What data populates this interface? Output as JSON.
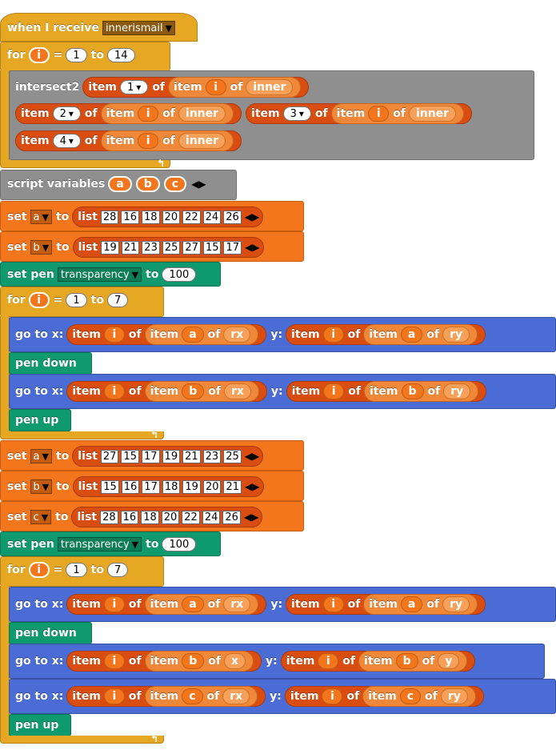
{
  "hat": {
    "label": "when I receive",
    "message": "innerismail"
  },
  "loop1": {
    "for_label": "for",
    "var": "i",
    "eq": "=",
    "from": "1",
    "to_label": "to",
    "to": "14"
  },
  "intersect": {
    "label": "intersect2",
    "item_label": "item",
    "of_label": "of",
    "list_name": "inner",
    "index_var": "i",
    "indices": [
      "1",
      "2",
      "3",
      "4"
    ]
  },
  "script_vars": {
    "label": "script variables",
    "vars": [
      "a",
      "b",
      "c"
    ]
  },
  "set_a1": {
    "set_label": "set",
    "var": "a",
    "to_label": "to",
    "list_label": "list",
    "values": [
      "28",
      "16",
      "18",
      "20",
      "22",
      "24",
      "26"
    ]
  },
  "set_b1": {
    "set_label": "set",
    "var": "b",
    "to_label": "to",
    "list_label": "list",
    "values": [
      "19",
      "21",
      "23",
      "25",
      "27",
      "15",
      "17"
    ]
  },
  "pen1": {
    "label": "set pen",
    "property": "transparency",
    "to_label": "to",
    "value": "100"
  },
  "loop2": {
    "for_label": "for",
    "var": "i",
    "eq": "=",
    "from": "1",
    "to_label": "to",
    "to": "7"
  },
  "goto_labels": {
    "goto": "go to x:",
    "y": "y:",
    "item": "item",
    "of": "of",
    "i": "i"
  },
  "goto1": {
    "x_var": "a",
    "x_list": "rx",
    "y_var": "a",
    "y_list": "ry"
  },
  "pen_down": "pen down",
  "goto2": {
    "x_var": "b",
    "x_list": "rx",
    "y_var": "b",
    "y_list": "ry"
  },
  "pen_up": "pen up",
  "set_a2": {
    "set_label": "set",
    "var": "a",
    "to_label": "to",
    "list_label": "list",
    "values": [
      "27",
      "15",
      "17",
      "19",
      "21",
      "23",
      "25"
    ]
  },
  "set_b2": {
    "set_label": "set",
    "var": "b",
    "to_label": "to",
    "list_label": "list",
    "values": [
      "15",
      "16",
      "17",
      "18",
      "19",
      "20",
      "21"
    ]
  },
  "set_c2": {
    "set_label": "set",
    "var": "c",
    "to_label": "to",
    "list_label": "list",
    "values": [
      "28",
      "16",
      "18",
      "20",
      "22",
      "24",
      "26"
    ]
  },
  "pen2": {
    "label": "set pen",
    "property": "transparency",
    "to_label": "to",
    "value": "100"
  },
  "loop3": {
    "for_label": "for",
    "var": "i",
    "eq": "=",
    "from": "1",
    "to_label": "to",
    "to": "7"
  },
  "goto3": {
    "x_var": "a",
    "x_list": "rx",
    "y_var": "a",
    "y_list": "ry"
  },
  "goto4": {
    "x_var": "b",
    "x_list": "x",
    "y_var": "b",
    "y_list": "y"
  },
  "goto5": {
    "x_var": "c",
    "x_list": "rx",
    "y_var": "c",
    "y_list": "ry"
  },
  "colors": {
    "control": "#e6a822",
    "variables": "#f3761d",
    "lists": "#d94d11",
    "other": "#8f8f8f",
    "pen": "#0e9a6c",
    "motion": "#4a6cd4"
  }
}
